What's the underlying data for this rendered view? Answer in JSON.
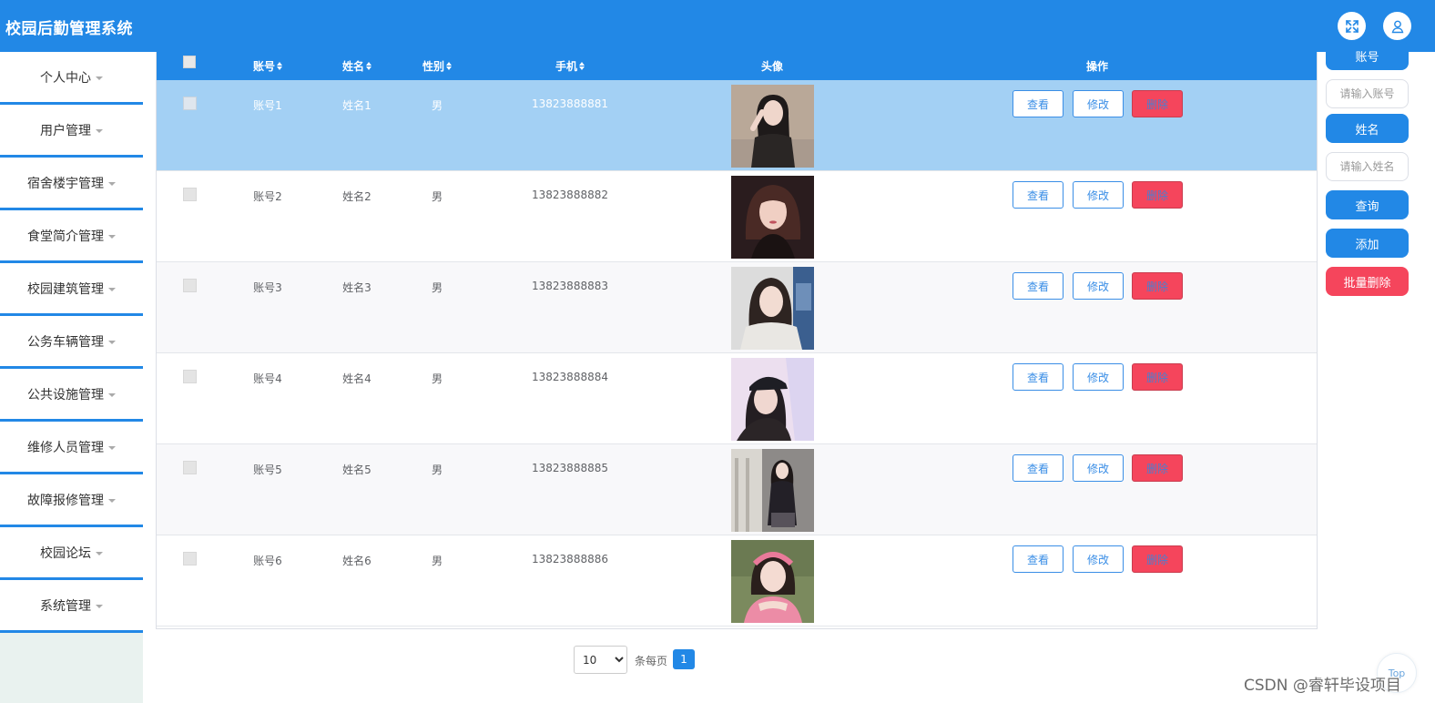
{
  "header": {
    "title": "校园后勤管理系统",
    "fullscreen_icon": "fullscreen-icon",
    "user_icon": "user-icon"
  },
  "sidebar": {
    "items": [
      {
        "label": "个人中心"
      },
      {
        "label": "用户管理"
      },
      {
        "label": "宿舍楼宇管理"
      },
      {
        "label": "食堂简介管理"
      },
      {
        "label": "校园建筑管理"
      },
      {
        "label": "公务车辆管理"
      },
      {
        "label": "公共设施管理"
      },
      {
        "label": "维修人员管理"
      },
      {
        "label": "故障报修管理"
      },
      {
        "label": "校园论坛"
      },
      {
        "label": "系统管理"
      }
    ]
  },
  "table": {
    "columns": {
      "account": "账号",
      "name": "姓名",
      "gender": "性别",
      "phone": "手机",
      "avatar": "头像",
      "actions": "操作"
    },
    "rows": [
      {
        "account": "账号1",
        "name": "姓名1",
        "gender": "男",
        "phone": "13823888881",
        "view": "查看",
        "edit": "修改",
        "delete": "删除",
        "selected": true
      },
      {
        "account": "账号2",
        "name": "姓名2",
        "gender": "男",
        "phone": "13823888882",
        "view": "查看",
        "edit": "修改",
        "delete": "删除"
      },
      {
        "account": "账号3",
        "name": "姓名3",
        "gender": "男",
        "phone": "13823888883",
        "view": "查看",
        "edit": "修改",
        "delete": "删除"
      },
      {
        "account": "账号4",
        "name": "姓名4",
        "gender": "男",
        "phone": "13823888884",
        "view": "查看",
        "edit": "修改",
        "delete": "删除"
      },
      {
        "account": "账号5",
        "name": "姓名5",
        "gender": "男",
        "phone": "13823888885",
        "view": "查看",
        "edit": "修改",
        "delete": "删除"
      },
      {
        "account": "账号6",
        "name": "姓名6",
        "gender": "男",
        "phone": "13823888886",
        "view": "查看",
        "edit": "修改",
        "delete": "删除"
      }
    ]
  },
  "search_panel": {
    "account_label": "账号",
    "account_placeholder": "请输入账号",
    "name_label": "姓名",
    "name_placeholder": "请输入姓名",
    "search_button": "查询",
    "add_button": "添加",
    "batch_delete_button": "批量删除"
  },
  "pagination": {
    "page_size": "10",
    "page_size_options": [
      "10"
    ],
    "per_page_label": "条每页",
    "current_page": "1"
  },
  "back_to_top": "Top",
  "watermark": "CSDN @睿轩毕设项目",
  "colors": {
    "primary": "#2288e6",
    "danger": "#f5455c",
    "selected_row": "#a3d0f4"
  }
}
